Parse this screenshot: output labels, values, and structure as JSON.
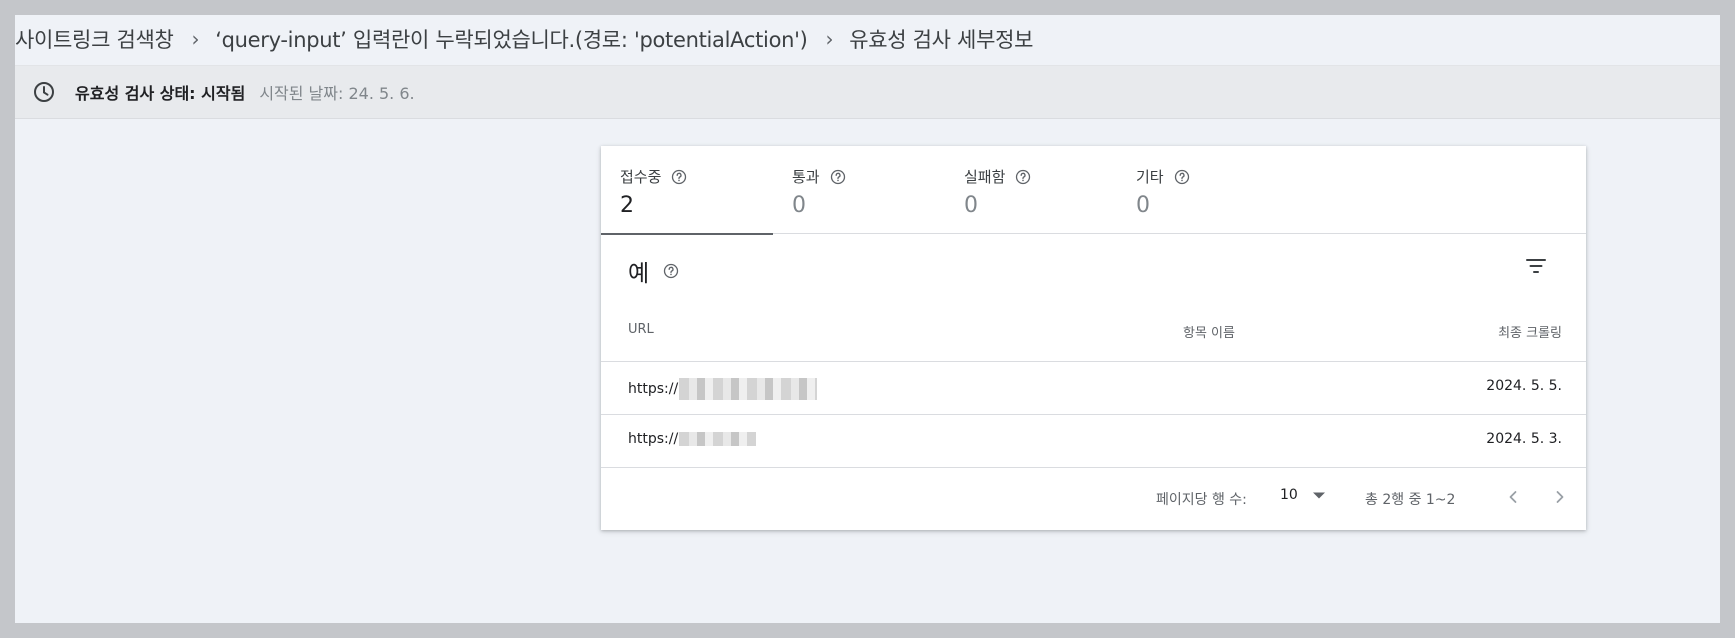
{
  "breadcrumb": {
    "items": [
      "사이트링크 검색창",
      "‘query-input’ 입력란이 누락되었습니다.(경로: 'potentialAction')",
      "유효성 검사 세부정보"
    ],
    "separator": "›"
  },
  "status": {
    "title": "유효성 검사 상태: 시작됨",
    "date": "시작된 날짜: 24. 5. 6.",
    "icon": "clock-icon"
  },
  "tabs": [
    {
      "label": "접수중",
      "count": "2",
      "active": true
    },
    {
      "label": "통과",
      "count": "0",
      "active": false
    },
    {
      "label": "실패함",
      "count": "0",
      "active": false
    },
    {
      "label": "기타",
      "count": "0",
      "active": false
    }
  ],
  "section": {
    "title": "예",
    "filter_icon": "filter-icon"
  },
  "table": {
    "columns": [
      "URL",
      "항목 이름",
      "최종 크롤링"
    ],
    "rows": [
      {
        "url": "https://",
        "item": "",
        "crawl": "2024. 5. 5."
      },
      {
        "url": "https://",
        "item": "",
        "crawl": "2024. 5. 3."
      }
    ]
  },
  "pagination": {
    "rows_per_page_label": "페이지당 행 수:",
    "rows_per_page_value": "10",
    "range": "총 2행 중 1~2"
  },
  "colors": {
    "frame_bg": "#eff2f7",
    "status_bg": "#e8eaed",
    "card_bg": "#ffffff",
    "active_tab_indicator": "#5f6368"
  }
}
